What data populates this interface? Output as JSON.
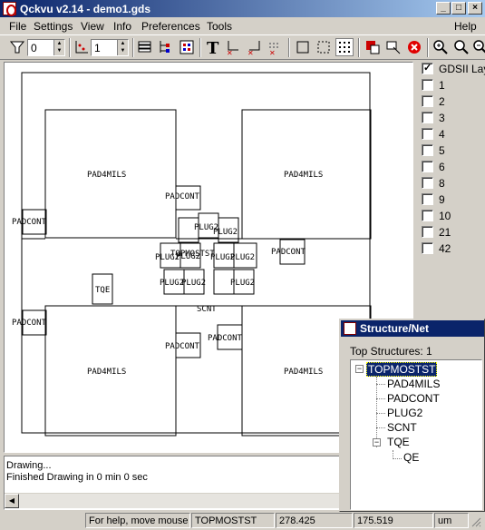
{
  "window": {
    "title": "Qckvu v2.14 - demo1.gds",
    "min": "_",
    "max": "□",
    "close": "×"
  },
  "menu": [
    "File",
    "Settings",
    "View",
    "Info",
    "Preferences",
    "Tools",
    "Help"
  ],
  "toolbar": {
    "filter_value": "0",
    "depth_value": "1"
  },
  "canvas": {
    "labels": {
      "pad_tl": "PAD4MILS",
      "pad_tr": "PAD4MILS",
      "pad_bl": "PAD4MILS",
      "pad_br": "PAD4MILS",
      "padcont_1": "PADCONT",
      "padcont_2": "PADCONT",
      "padcont_3": "PADCONT",
      "padcont_4": "PADCONT",
      "padcont_5": "PADCONT",
      "padcont_6": "PADCONT",
      "plug_1": "PLUG2",
      "plug_2": "PLUG2",
      "plug_3": "PLUG2",
      "plug_4": "PLUG2",
      "plug_5": "PLUG2",
      "plug_6": "PLUG2",
      "plug_7": "PLUG2",
      "plug_8": "PLUG2",
      "plug_9": "PLUG2",
      "topmost": "TOPMOSTST",
      "tqe": "TQE",
      "scnt": "SCNT"
    }
  },
  "layers": [
    {
      "label": "GDSII Layers",
      "checked": true
    },
    {
      "label": "1",
      "checked": false
    },
    {
      "label": "2",
      "checked": false
    },
    {
      "label": "3",
      "checked": false
    },
    {
      "label": "4",
      "checked": false
    },
    {
      "label": "5",
      "checked": false
    },
    {
      "label": "6",
      "checked": false
    },
    {
      "label": "8",
      "checked": false
    },
    {
      "label": "9",
      "checked": false
    },
    {
      "label": "10",
      "checked": false
    },
    {
      "label": "21",
      "checked": false
    },
    {
      "label": "42",
      "checked": false
    }
  ],
  "log": {
    "line1": "Drawing...",
    "line2": "Finished Drawing in 0 min 0 sec"
  },
  "statusbar": {
    "help": "For help, move mouse t",
    "structure": "TOPMOSTST",
    "x": "278.425",
    "y": "175.519",
    "units": "um"
  },
  "structure_window": {
    "title": "Structure/Net",
    "top_count": "Top Structures: 1",
    "tree": {
      "root": "TOPMOSTST",
      "c1": "PAD4MILS",
      "c2": "PADCONT",
      "c3": "PLUG2",
      "c4": "SCNT",
      "c5": "TQE",
      "c5a": "QE"
    }
  },
  "colors": {
    "titlebar": "#0a246a",
    "face": "#d4d0c8",
    "canvas": "#ffffff",
    "selection": "#0a246a"
  }
}
